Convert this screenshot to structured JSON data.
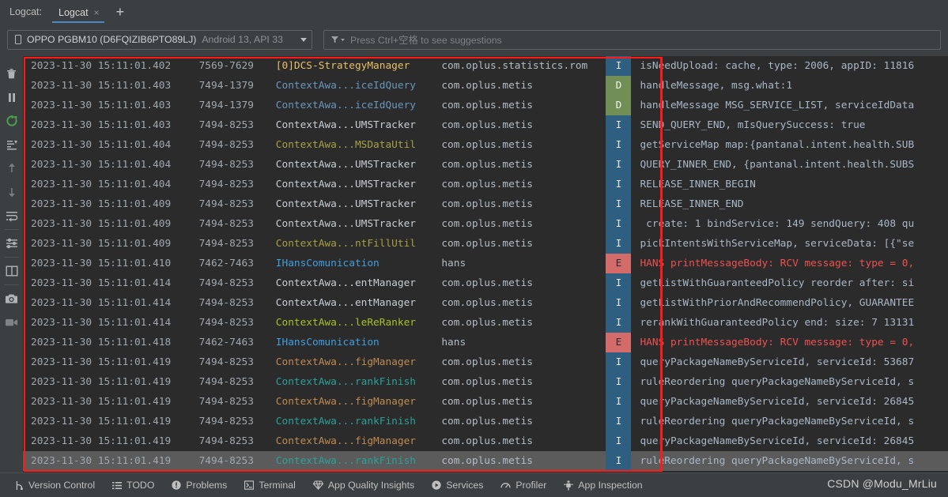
{
  "tabbar": {
    "title": "Logcat:",
    "tab_label": "Logcat",
    "close_label": "×",
    "add_label": "+"
  },
  "toolbar": {
    "device_name": "OPPO PGBM10 (D6FQIZIB6PTO89LJ)",
    "device_meta": "Android 13, API 33",
    "filter_placeholder": "Press Ctrl+空格 to see suggestions"
  },
  "rail": {
    "items": [
      {
        "name": "clear-logcat-icon",
        "label": "Clear Logcat"
      },
      {
        "name": "pause-icon",
        "label": "Pause"
      },
      {
        "name": "restart-icon",
        "label": "Restart Logcat"
      },
      {
        "name": "scroll-to-end-icon",
        "label": "Scroll to End"
      },
      {
        "name": "previous-occurrence-icon",
        "label": "Previous Occurrence"
      },
      {
        "name": "next-occurrence-icon",
        "label": "Next Occurrence"
      },
      {
        "name": "soft-wrap-icon",
        "label": "Soft-Wrap"
      },
      {
        "name": "configure-icon",
        "label": "Configure Logcat Formatting Options"
      },
      {
        "name": "split-panel-icon",
        "label": "Split Panels"
      },
      {
        "name": "screenshot-icon",
        "label": "Take Screenshot"
      },
      {
        "name": "screen-record-icon",
        "label": "Record Screen"
      }
    ]
  },
  "log": {
    "columns": [
      "timestamp",
      "pid",
      "tag",
      "package",
      "level",
      "message"
    ],
    "colors": {
      "level_I_bg": "#2e5f80",
      "level_D_bg": "#718e56",
      "level_E_bg": "#d46b6b",
      "error_text": "#f05050",
      "highlight_box": "#ff1a1a",
      "panel_bg": "#2b2b2b"
    },
    "rows": [
      {
        "ts": "2023-11-30 15:11:01.402",
        "pid": "7569-7629",
        "tag": "[0]DCS-StrategyManager",
        "tag_color": "#e8bf6a",
        "pkg": "com.oplus.statistics.rom",
        "lvl": "I",
        "msg": "isNeedUpload: cache, type: 2006, appID: 11816",
        "msg_color": "#a9b7c6",
        "selected": false
      },
      {
        "ts": "2023-11-30 15:11:01.403",
        "pid": "7494-1379",
        "tag": "ContextAwa...iceIdQuery",
        "tag_color": "#6897bb",
        "pkg": "com.oplus.metis",
        "lvl": "D",
        "msg": "handleMessage, msg.what:1",
        "msg_color": "#a9b7c6",
        "selected": false
      },
      {
        "ts": "2023-11-30 15:11:01.403",
        "pid": "7494-1379",
        "tag": "ContextAwa...iceIdQuery",
        "tag_color": "#6897bb",
        "pkg": "com.oplus.metis",
        "lvl": "D",
        "msg": "handleMessage MSG_SERVICE_LIST, serviceIdData",
        "msg_color": "#a9b7c6",
        "selected": false
      },
      {
        "ts": "2023-11-30 15:11:01.403",
        "pid": "7494-8253",
        "tag": "ContextAwa...UMSTracker",
        "tag_color": "#c8cdd2",
        "pkg": "com.oplus.metis",
        "lvl": "I",
        "msg": "SEND_QUERY_END, mIsQuerySuccess: true",
        "msg_color": "#a9b7c6",
        "selected": false
      },
      {
        "ts": "2023-11-30 15:11:01.404",
        "pid": "7494-8253",
        "tag": "ContextAwa...MSDataUtil",
        "tag_color": "#a5a043",
        "pkg": "com.oplus.metis",
        "lvl": "I",
        "msg": "getServiceMap map:{pantanal.intent.health.SUB",
        "msg_color": "#a9b7c6",
        "selected": false
      },
      {
        "ts": "2023-11-30 15:11:01.404",
        "pid": "7494-8253",
        "tag": "ContextAwa...UMSTracker",
        "tag_color": "#c8cdd2",
        "pkg": "com.oplus.metis",
        "lvl": "I",
        "msg": "QUERY_INNER_END, {pantanal.intent.health.SUBS",
        "msg_color": "#a9b7c6",
        "selected": false
      },
      {
        "ts": "2023-11-30 15:11:01.404",
        "pid": "7494-8253",
        "tag": "ContextAwa...UMSTracker",
        "tag_color": "#c8cdd2",
        "pkg": "com.oplus.metis",
        "lvl": "I",
        "msg": "RELEASE_INNER_BEGIN",
        "msg_color": "#a9b7c6",
        "selected": false
      },
      {
        "ts": "2023-11-30 15:11:01.409",
        "pid": "7494-8253",
        "tag": "ContextAwa...UMSTracker",
        "tag_color": "#c8cdd2",
        "pkg": "com.oplus.metis",
        "lvl": "I",
        "msg": "RELEASE_INNER_END",
        "msg_color": "#a9b7c6",
        "selected": false
      },
      {
        "ts": "2023-11-30 15:11:01.409",
        "pid": "7494-8253",
        "tag": "ContextAwa...UMSTracker",
        "tag_color": "#c8cdd2",
        "pkg": "com.oplus.metis",
        "lvl": "I",
        "msg": " create: 1 bindService: 149 sendQuery: 408 qu",
        "msg_color": "#a9b7c6",
        "selected": false
      },
      {
        "ts": "2023-11-30 15:11:01.409",
        "pid": "7494-8253",
        "tag": "ContextAwa...ntFillUtil",
        "tag_color": "#a5a043",
        "pkg": "com.oplus.metis",
        "lvl": "I",
        "msg": "pickIntentsWithServiceMap, serviceData: [{\"se",
        "msg_color": "#a9b7c6",
        "selected": false
      },
      {
        "ts": "2023-11-30 15:11:01.410",
        "pid": "7462-7463",
        "tag": "IHansComunication",
        "tag_color": "#3f9fe0",
        "pkg": "hans",
        "lvl": "E",
        "msg": "HANS printMessageBody: RCV message: type = 0,",
        "msg_color": "#f05050",
        "selected": false
      },
      {
        "ts": "2023-11-30 15:11:01.414",
        "pid": "7494-8253",
        "tag": "ContextAwa...entManager",
        "tag_color": "#c8cdd2",
        "pkg": "com.oplus.metis",
        "lvl": "I",
        "msg": "getListWithGuaranteedPolicy reorder after: si",
        "msg_color": "#a9b7c6",
        "selected": false
      },
      {
        "ts": "2023-11-30 15:11:01.414",
        "pid": "7494-8253",
        "tag": "ContextAwa...entManager",
        "tag_color": "#c8cdd2",
        "pkg": "com.oplus.metis",
        "lvl": "I",
        "msg": "getListWithPriorAndRecommendPolicy, GUARANTEE",
        "msg_color": "#a9b7c6",
        "selected": false
      },
      {
        "ts": "2023-11-30 15:11:01.414",
        "pid": "7494-8253",
        "tag": "ContextAwa...leReRanker",
        "tag_color": "#a8c023",
        "pkg": "com.oplus.metis",
        "lvl": "I",
        "msg": "rerankWithGuaranteedPolicy end: size: 7 13131",
        "msg_color": "#a9b7c6",
        "selected": false
      },
      {
        "ts": "2023-11-30 15:11:01.418",
        "pid": "7462-7463",
        "tag": "IHansComunication",
        "tag_color": "#3f9fe0",
        "pkg": "hans",
        "lvl": "E",
        "msg": "HANS printMessageBody: RCV message: type = 0,",
        "msg_color": "#f05050",
        "selected": false
      },
      {
        "ts": "2023-11-30 15:11:01.419",
        "pid": "7494-8253",
        "tag": "ContextAwa...figManager",
        "tag_color": "#c08a50",
        "pkg": "com.oplus.metis",
        "lvl": "I",
        "msg": "queryPackageNameByServiceId, serviceId: 53687",
        "msg_color": "#a9b7c6",
        "selected": false
      },
      {
        "ts": "2023-11-30 15:11:01.419",
        "pid": "7494-8253",
        "tag": "ContextAwa...rankFinish",
        "tag_color": "#2aa198",
        "pkg": "com.oplus.metis",
        "lvl": "I",
        "msg": "ruleReordering queryPackageNameByServiceId, s",
        "msg_color": "#a9b7c6",
        "selected": false
      },
      {
        "ts": "2023-11-30 15:11:01.419",
        "pid": "7494-8253",
        "tag": "ContextAwa...figManager",
        "tag_color": "#c08a50",
        "pkg": "com.oplus.metis",
        "lvl": "I",
        "msg": "queryPackageNameByServiceId, serviceId: 26845",
        "msg_color": "#a9b7c6",
        "selected": false
      },
      {
        "ts": "2023-11-30 15:11:01.419",
        "pid": "7494-8253",
        "tag": "ContextAwa...rankFinish",
        "tag_color": "#2aa198",
        "pkg": "com.oplus.metis",
        "lvl": "I",
        "msg": "ruleReordering queryPackageNameByServiceId, s",
        "msg_color": "#a9b7c6",
        "selected": false
      },
      {
        "ts": "2023-11-30 15:11:01.419",
        "pid": "7494-8253",
        "tag": "ContextAwa...figManager",
        "tag_color": "#c08a50",
        "pkg": "com.oplus.metis",
        "lvl": "I",
        "msg": "queryPackageNameByServiceId, serviceId: 26845",
        "msg_color": "#a9b7c6",
        "selected": false
      },
      {
        "ts": "2023-11-30 15:11:01.419",
        "pid": "7494-8253",
        "tag": "ContextAwa...rankFinish",
        "tag_color": "#2aa198",
        "pkg": "com.oplus.metis",
        "lvl": "I",
        "msg": "ruleReordering queryPackageNameByServiceId, s",
        "msg_color": "#a9b7c6",
        "selected": true
      }
    ]
  },
  "statusbar": {
    "items": [
      {
        "name": "version-control",
        "label": "Version Control",
        "icon": "branch-icon"
      },
      {
        "name": "todo",
        "label": "TODO",
        "icon": "list-icon"
      },
      {
        "name": "problems",
        "label": "Problems",
        "icon": "exclamation-circle-icon"
      },
      {
        "name": "terminal",
        "label": "Terminal",
        "icon": "terminal-icon"
      },
      {
        "name": "app-quality-insights",
        "label": "App Quality Insights",
        "icon": "gem-icon"
      },
      {
        "name": "services",
        "label": "Services",
        "icon": "play-circle-icon"
      },
      {
        "name": "profiler",
        "label": "Profiler",
        "icon": "gauge-icon"
      },
      {
        "name": "app-inspection",
        "label": "App Inspection",
        "icon": "magnifier-bug-icon"
      }
    ],
    "watermark": "CSDN @Modu_MrLiu"
  }
}
